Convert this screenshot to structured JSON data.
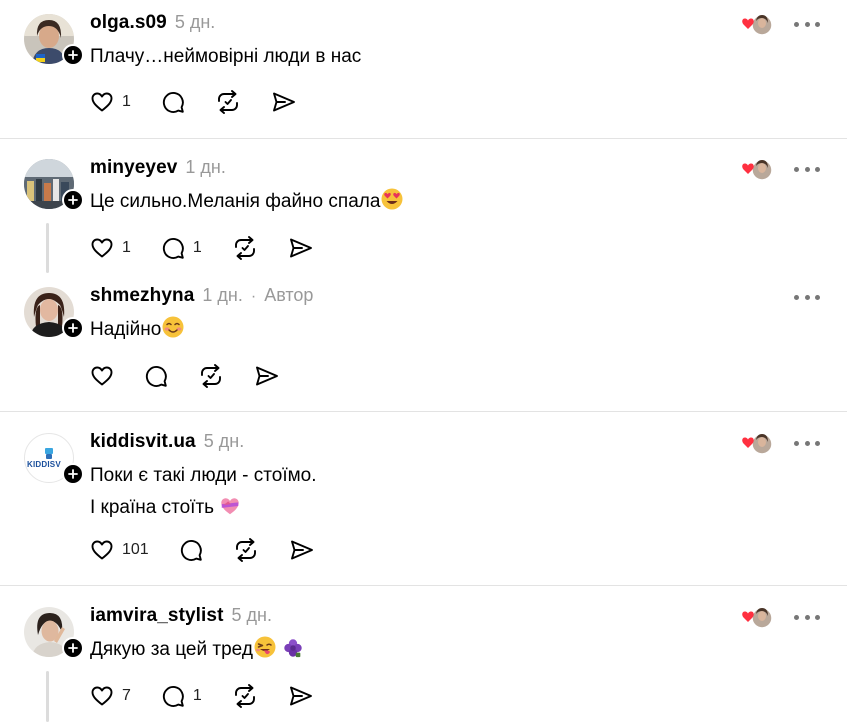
{
  "posts": [
    {
      "username": "olga.s09",
      "time": "5 дн.",
      "lines": [
        "Плачу…неймовірні люди в нас"
      ],
      "likes": "1",
      "replies": ""
    },
    {
      "username": "minyeyev",
      "time": "1 дн.",
      "lines": [
        "Це сильно.Меланія файно спала"
      ],
      "likes": "1",
      "replies": "1"
    },
    {
      "username": "shmezhyna",
      "time": "1 дн.",
      "separator": "·",
      "author_label": "Автор",
      "lines": [
        "Надійно"
      ],
      "likes": "",
      "replies": ""
    },
    {
      "username": "kiddisvit.ua",
      "time": "5 дн.",
      "avatar_text": "KIDDISV",
      "lines": [
        "Поки є такі люди - стоїмо.",
        "І країна стоїть"
      ],
      "likes": "101",
      "replies": ""
    },
    {
      "username": "iamvira_stylist",
      "time": "5 дн.",
      "lines": [
        "Дякую за цей тред"
      ],
      "likes": "7",
      "replies": "1"
    }
  ],
  "icons": {
    "like": "heart-icon",
    "reply": "comment-icon",
    "repost": "repost-icon",
    "share": "send-icon",
    "more": "more-icon",
    "follow": "plus-icon"
  },
  "colors": {
    "heart_badge": "#ff3040",
    "muted_text": "#999999",
    "separator": "#e3e3e3",
    "thread_line": "#dcdcdc"
  }
}
